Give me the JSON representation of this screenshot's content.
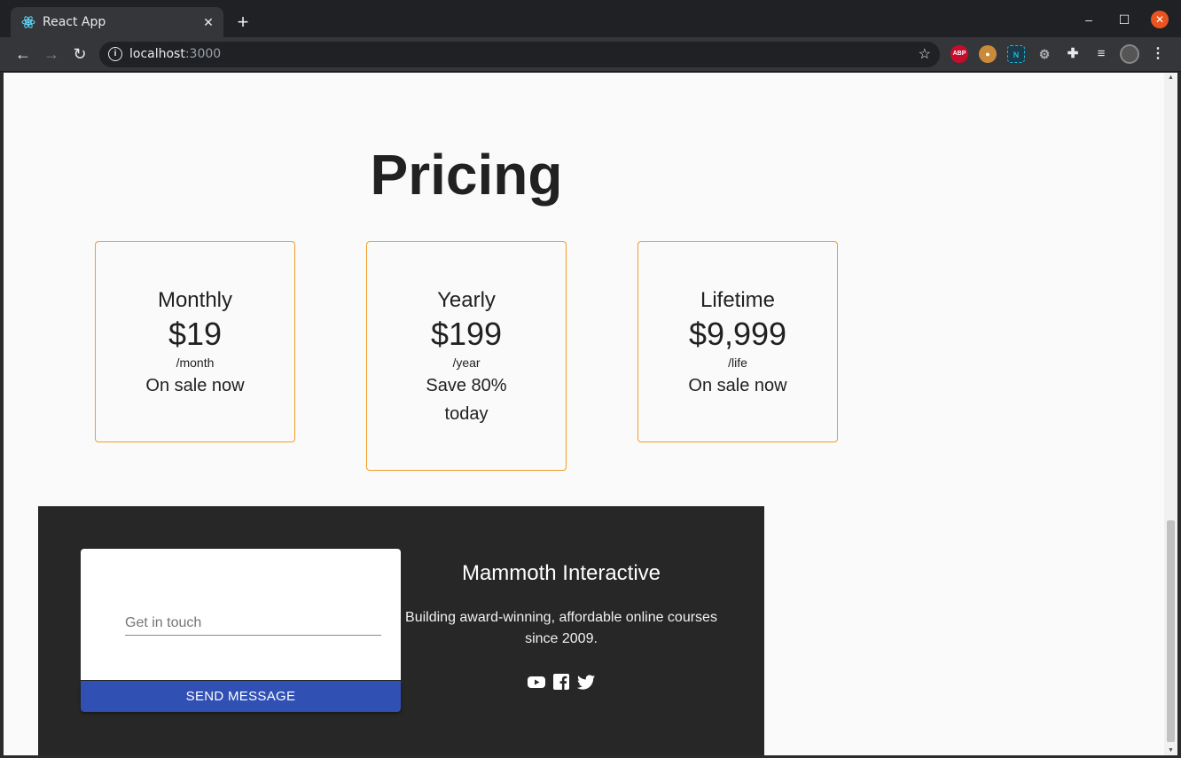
{
  "browser": {
    "tab_title": "React App",
    "url_host": "localhost",
    "url_port": ":3000",
    "extensions": {
      "abp_label": "ABP",
      "n_label": "N"
    }
  },
  "page": {
    "title": "Pricing",
    "plans": [
      {
        "name": "Monthly",
        "price": "$19",
        "period": "/month",
        "note": "On sale now"
      },
      {
        "name": "Yearly",
        "price": "$199",
        "period": "/year",
        "note": "Save 80% today"
      },
      {
        "name": "Lifetime",
        "price": "$9,999",
        "period": "/life",
        "note": "On sale now"
      }
    ],
    "accent_color": "#f39c2b"
  },
  "footer": {
    "input_placeholder": "Get in touch",
    "send_label": "SEND MESSAGE",
    "company": "Mammoth Interactive",
    "tagline": "Building award-winning, affordable online courses since 2009.",
    "socials": [
      "youtube-icon",
      "facebook-icon",
      "twitter-icon"
    ],
    "button_color": "#3050b4",
    "background_color": "#272727"
  }
}
